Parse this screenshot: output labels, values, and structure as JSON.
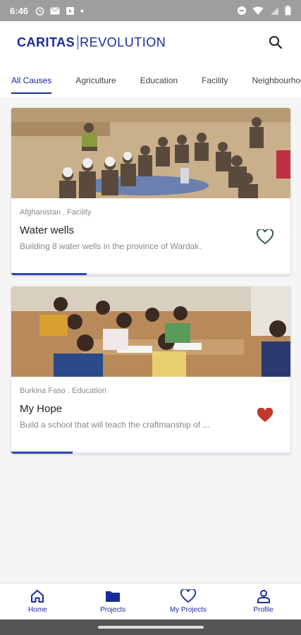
{
  "status_bar": {
    "time": "6:46"
  },
  "header": {
    "brand_bold": "CARITAS",
    "brand_light": "REVOLUTION",
    "search_icon": "search-icon"
  },
  "tabs": [
    {
      "label": "All Causes",
      "active": true
    },
    {
      "label": "Agriculture",
      "active": false
    },
    {
      "label": "Education",
      "active": false
    },
    {
      "label": "Facility",
      "active": false
    },
    {
      "label": "Neighbourhood",
      "active": false
    }
  ],
  "projects": [
    {
      "meta": "Afghanistan . Facility",
      "title": "Water wells",
      "description": "Building 8 water wells in the province of Wardak.",
      "liked": false,
      "progress_fraction": 0.27
    },
    {
      "meta": "Burkina Faso . Education",
      "title": "My Hope",
      "description": "Build a school that will teach the craftmanship of ...",
      "liked": true,
      "progress_fraction": 0.22
    }
  ],
  "bottom_nav": [
    {
      "label": "Home",
      "icon": "home-icon"
    },
    {
      "label": "Projects",
      "icon": "folder-icon"
    },
    {
      "label": "My Projects",
      "icon": "heart-icon"
    },
    {
      "label": "Profile",
      "icon": "person-icon"
    }
  ],
  "colors": {
    "brand": "#1a2a9a",
    "like": "#c0392b"
  }
}
